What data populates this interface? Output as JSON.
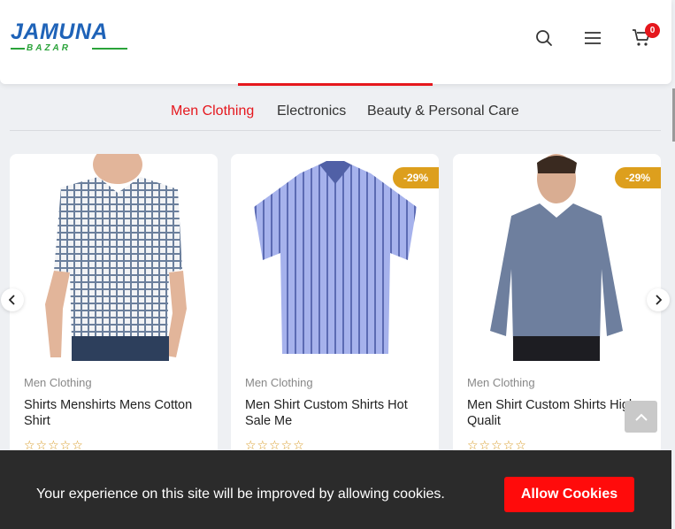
{
  "header": {
    "logo_top": "JAMUNA",
    "logo_bottom": "BAZAR",
    "cart_count": "0"
  },
  "tabs": [
    {
      "label": "Men Clothing",
      "active": true
    },
    {
      "label": "Electronics",
      "active": false
    },
    {
      "label": "Beauty & Personal Care",
      "active": false
    }
  ],
  "products": [
    {
      "category": "Men Clothing",
      "title": "Shirts Menshirts Mens Cotton Shirt",
      "discount": "",
      "rating": 0
    },
    {
      "category": "Men Clothing",
      "title": "Men Shirt Custom Shirts Hot Sale Me",
      "discount": "-29%",
      "rating": 0
    },
    {
      "category": "Men Clothing",
      "title": "Men Shirt Custom Shirts High Qualit",
      "discount": "-29%",
      "rating": 0
    }
  ],
  "stars": "☆☆☆☆☆",
  "cookie": {
    "message": "Your experience on this site will be improved by allowing cookies.",
    "button": "Allow Cookies"
  },
  "colors": {
    "accent": "#e5171d",
    "badge": "#dd9f1d",
    "brand_blue": "#1f63b8",
    "brand_green": "#2aa33a"
  }
}
